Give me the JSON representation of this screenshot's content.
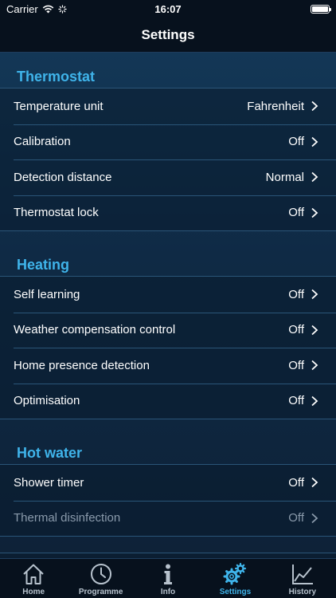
{
  "status_bar": {
    "carrier": "Carrier",
    "time": "16:07"
  },
  "nav": {
    "title": "Settings"
  },
  "sections": [
    {
      "title": "Thermostat",
      "rows": [
        {
          "label": "Temperature unit",
          "value": "Fahrenheit"
        },
        {
          "label": "Calibration",
          "value": "Off"
        },
        {
          "label": "Detection distance",
          "value": "Normal"
        },
        {
          "label": "Thermostat lock",
          "value": "Off"
        }
      ]
    },
    {
      "title": "Heating",
      "rows": [
        {
          "label": "Self learning",
          "value": "Off"
        },
        {
          "label": "Weather compensation control",
          "value": "Off"
        },
        {
          "label": "Home presence detection",
          "value": "Off"
        },
        {
          "label": "Optimisation",
          "value": "Off"
        }
      ]
    },
    {
      "title": "Hot water",
      "rows": [
        {
          "label": "Shower timer",
          "value": "Off"
        },
        {
          "label": "Thermal disinfection",
          "value": "Off",
          "disabled": true
        }
      ]
    }
  ],
  "tabs": [
    {
      "label": "Home",
      "icon": "home-icon"
    },
    {
      "label": "Programme",
      "icon": "clock-icon"
    },
    {
      "label": "Info",
      "icon": "info-icon"
    },
    {
      "label": "Settings",
      "icon": "gears-icon",
      "active": true
    },
    {
      "label": "History",
      "icon": "chart-icon"
    }
  ],
  "colors": {
    "accent": "#3fb4ea",
    "background": "#0d1a2b",
    "disabled_text": "#8a9aab"
  }
}
